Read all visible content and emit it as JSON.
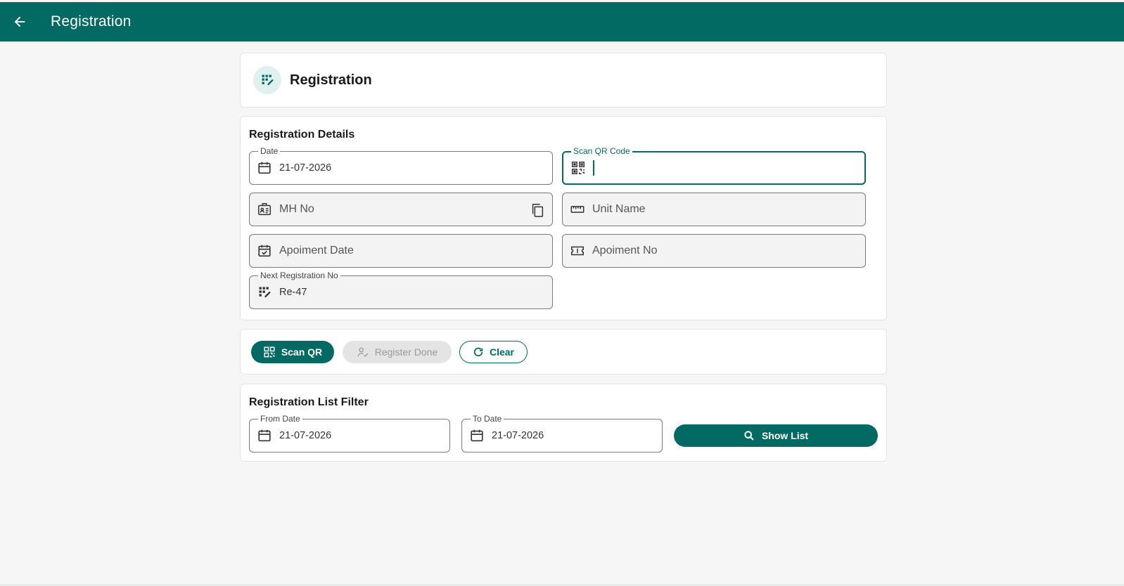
{
  "appbar": {
    "title": "Registration"
  },
  "header": {
    "title": "Registration"
  },
  "details": {
    "title": "Registration Details",
    "date": {
      "label": "Date",
      "value": "21-07-2026"
    },
    "scan_qr": {
      "label": "Scan QR Code",
      "value": ""
    },
    "mh_no": {
      "placeholder": "MH No"
    },
    "unit_name": {
      "placeholder": "Unit Name"
    },
    "appointment_date": {
      "placeholder": "Apoiment Date"
    },
    "appointment_no": {
      "placeholder": "Apoiment No"
    },
    "next_reg": {
      "label": "Next Registration No",
      "value": "Re-47"
    }
  },
  "actions": {
    "scan_qr": "Scan QR",
    "register_done": "Register Done",
    "clear": "Clear"
  },
  "filter": {
    "title": "Registration List Filter",
    "from_date": {
      "label": "From Date",
      "value": "21-07-2026"
    },
    "to_date": {
      "label": "To Date",
      "value": "21-07-2026"
    },
    "show_list": "Show List"
  },
  "colors": {
    "primary": "#026a62",
    "background": "#f6f6f6"
  }
}
